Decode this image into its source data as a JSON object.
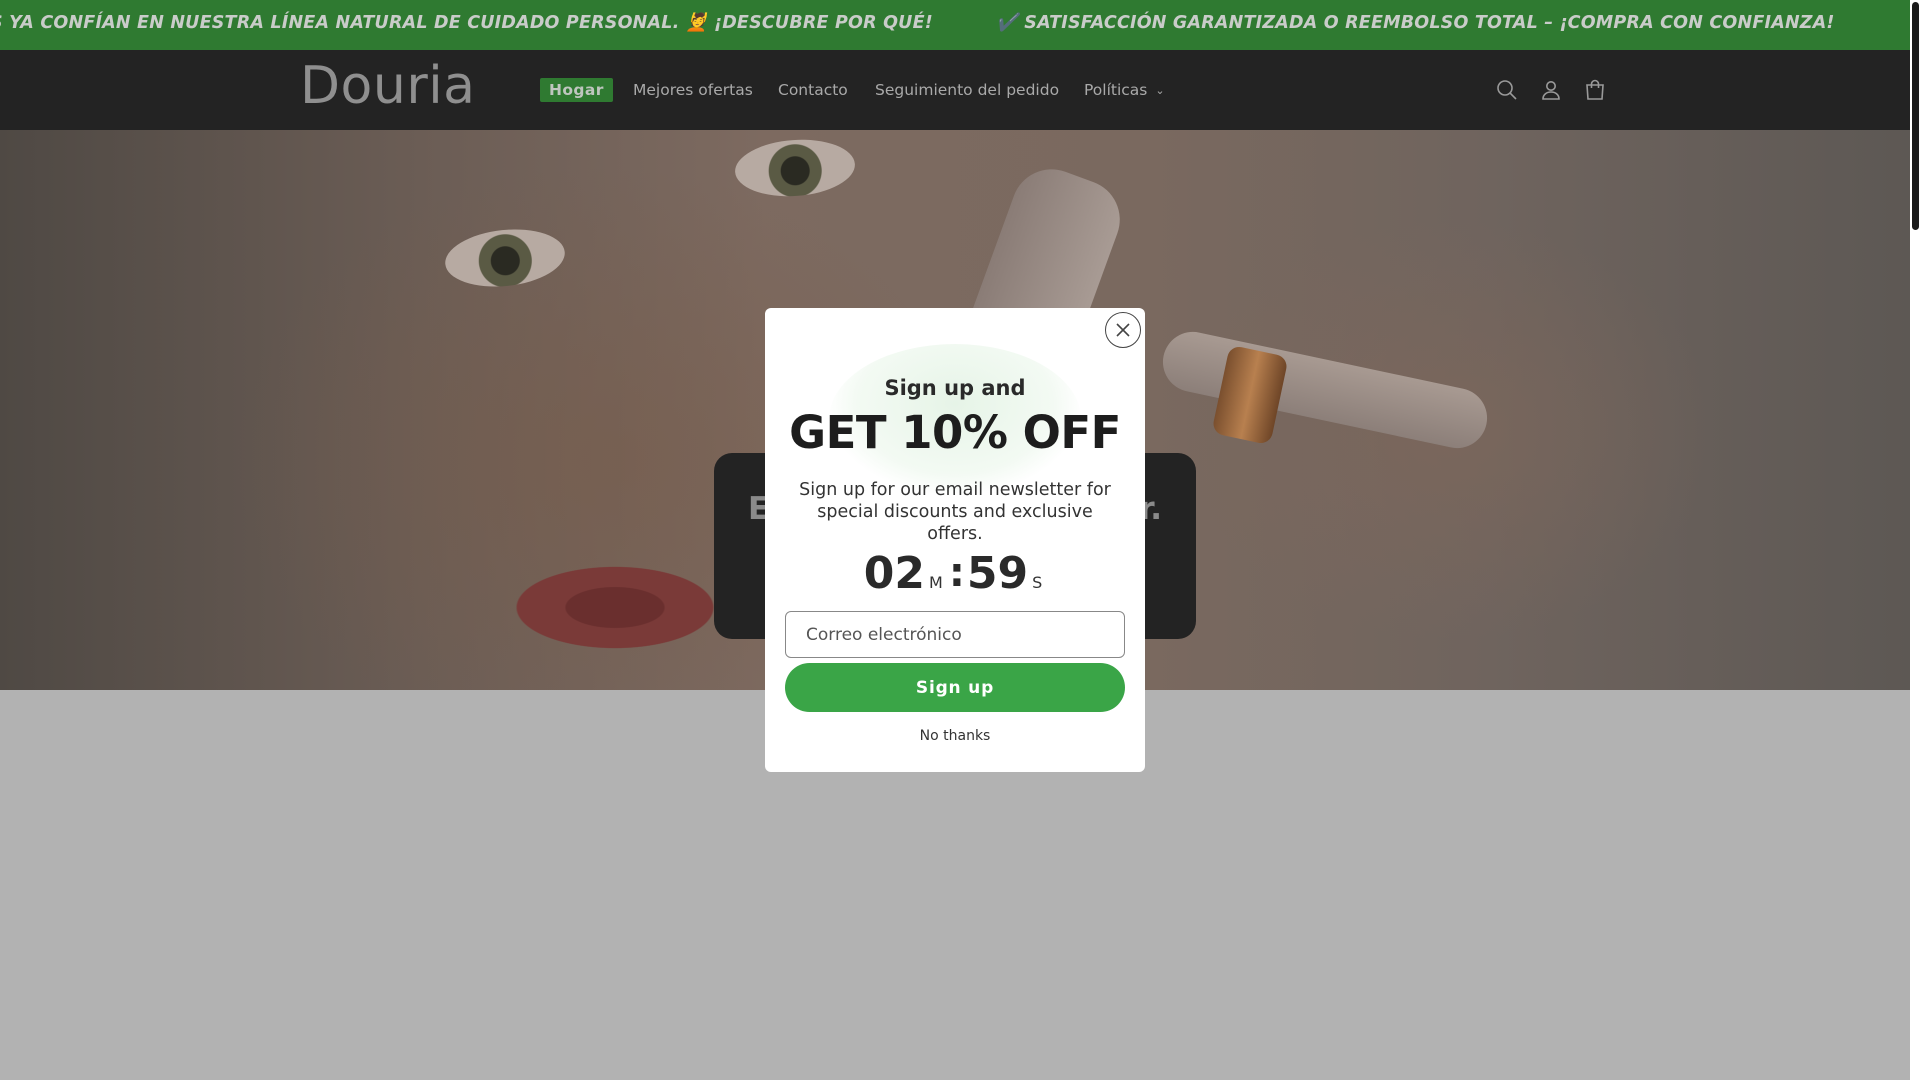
{
  "announcement": {
    "items": [
      "S YA CONFÍAN EN NUESTRA LÍNEA NATURAL DE CUIDADO PERSONAL. 💆 ¡DESCUBRE POR QUÉ!",
      "✔️ SATISFACCIÓN GARANTIZADA O REEMBOLSO TOTAL – ¡COMPRA CON CONFIANZA!"
    ],
    "background": "#2f7a31"
  },
  "header": {
    "logo": "Douria",
    "nav": [
      {
        "label": "Hogar",
        "active": true
      },
      {
        "label": "Mejores ofertas"
      },
      {
        "label": "Contacto"
      },
      {
        "label": "Seguimiento del pedido"
      },
      {
        "label": "Políticas",
        "dropdown": true
      }
    ],
    "icons": [
      "search-icon",
      "account-icon",
      "cart-icon"
    ]
  },
  "hero": {
    "box_left": "E",
    "box_right": "r."
  },
  "popup": {
    "pre_title": "Sign up and",
    "headline": "GET 10% OFF",
    "description": "Sign up for our email newsletter for special discounts and exclusive offers.",
    "timer": {
      "minutes": "02",
      "minutes_unit": "M",
      "seconds": "59",
      "seconds_unit": "S"
    },
    "email_placeholder": "Correo electrónico",
    "signup_label": "Sign up",
    "no_thanks_label": "No thanks",
    "accent": "#3aa547"
  }
}
